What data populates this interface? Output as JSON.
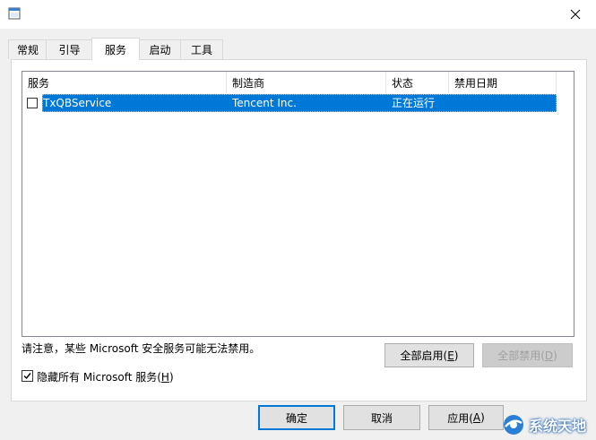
{
  "tabs": [
    "常规",
    "引导",
    "服务",
    "启动",
    "工具"
  ],
  "active_tab": 2,
  "columns": [
    "服务",
    "制造商",
    "状态",
    "禁用日期"
  ],
  "rows": [
    {
      "service": "TxQBService",
      "vendor": "Tencent Inc.",
      "status": "正在运行",
      "disabled_date": "",
      "checked": false,
      "selected": true
    }
  ],
  "note": "请注意，某些 Microsoft 安全服务可能无法禁用。",
  "enable_all": {
    "label": "全部启用(",
    "key": "E",
    "suffix": ")"
  },
  "disable_all": {
    "label": "全部禁用(",
    "key": "D",
    "suffix": ")"
  },
  "hide_ms": {
    "label": "隐藏所有 Microsoft 服务(",
    "key": "H",
    "suffix": ")",
    "checked": true
  },
  "ok_label": "确定",
  "cancel_label": "取消",
  "apply": {
    "label": "应用(",
    "key": "A",
    "suffix": ")"
  },
  "watermark": "系统天地",
  "colors": {
    "selection": "#0078d7",
    "accent": "#0078d7"
  }
}
